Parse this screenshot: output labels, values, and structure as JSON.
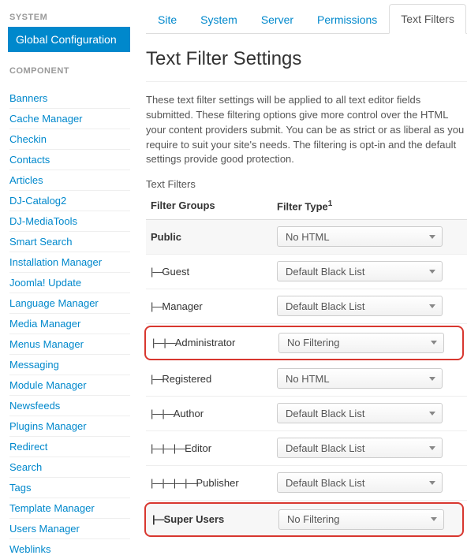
{
  "sidebar": {
    "system_head": "SYSTEM",
    "active_item": "Global Configuration",
    "component_head": "COMPONENT",
    "items": [
      "Banners",
      "Cache Manager",
      "Checkin",
      "Contacts",
      "Articles",
      "DJ-Catalog2",
      "DJ-MediaTools",
      "Smart Search",
      "Installation Manager",
      "Joomla! Update",
      "Language Manager",
      "Media Manager",
      "Menus Manager",
      "Messaging",
      "Module Manager",
      "Newsfeeds",
      "Plugins Manager",
      "Redirect",
      "Search",
      "Tags",
      "Template Manager",
      "Users Manager",
      "Weblinks"
    ]
  },
  "tabs": [
    {
      "label": "Site",
      "active": false
    },
    {
      "label": "System",
      "active": false
    },
    {
      "label": "Server",
      "active": false
    },
    {
      "label": "Permissions",
      "active": false
    },
    {
      "label": "Text Filters",
      "active": true
    }
  ],
  "heading": "Text Filter Settings",
  "description": "These text filter settings will be applied to all text editor fields submitted. These filtering options give more control over the HTML your content providers submit. You can be as strict or as liberal as you require to suit your site's needs. The filtering is opt-in and the default settings provide good protection.",
  "subhead": "Text Filters",
  "columns": {
    "group": "Filter Groups",
    "type": "Filter Type",
    "sup": "1"
  },
  "rows": [
    {
      "label": "Public",
      "prefix": "",
      "value": "No HTML",
      "bold": true,
      "highlight": false
    },
    {
      "label": "Guest",
      "prefix": "|—",
      "value": "Default Black List",
      "bold": false,
      "highlight": false
    },
    {
      "label": "Manager",
      "prefix": "|—",
      "value": "Default Black List",
      "bold": false,
      "highlight": false
    },
    {
      "label": "Administrator",
      "prefix": "|—|—",
      "value": "No Filtering",
      "bold": false,
      "highlight": true
    },
    {
      "label": "Registered",
      "prefix": "|—",
      "value": "No HTML",
      "bold": false,
      "highlight": false
    },
    {
      "label": "Author",
      "prefix": "|—|—",
      "value": "Default Black List",
      "bold": false,
      "highlight": false
    },
    {
      "label": "Editor",
      "prefix": "|—|—|—",
      "value": "Default Black List",
      "bold": false,
      "highlight": false
    },
    {
      "label": "Publisher",
      "prefix": "|—|—|—|—",
      "value": "Default Black List",
      "bold": false,
      "highlight": false
    },
    {
      "label": "Super Users",
      "prefix": "|—",
      "value": "No Filtering",
      "bold": true,
      "highlight": true
    }
  ]
}
